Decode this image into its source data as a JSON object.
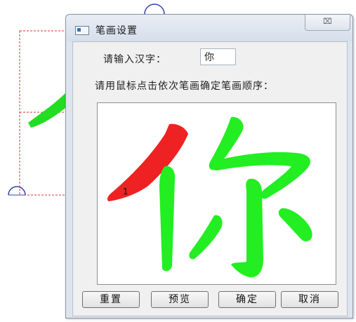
{
  "dialog": {
    "title": "笔画设置",
    "close_label": "⌧"
  },
  "form": {
    "input_label": "请输入汉字：",
    "input_value": "你",
    "instruction": "请用鼠标点击依次笔画确定笔画顺序："
  },
  "canvas": {
    "character": "你",
    "stroke_order_marker": "1",
    "colors": {
      "selected_stroke": "#ee2222",
      "unselected_stroke": "#22ee22",
      "background_char": "#22dd22",
      "guide_line": "#dd3333",
      "handle": "#3344aa"
    }
  },
  "buttons": {
    "reset": "重置",
    "preview": "预览",
    "confirm": "确定",
    "cancel": "取消"
  }
}
